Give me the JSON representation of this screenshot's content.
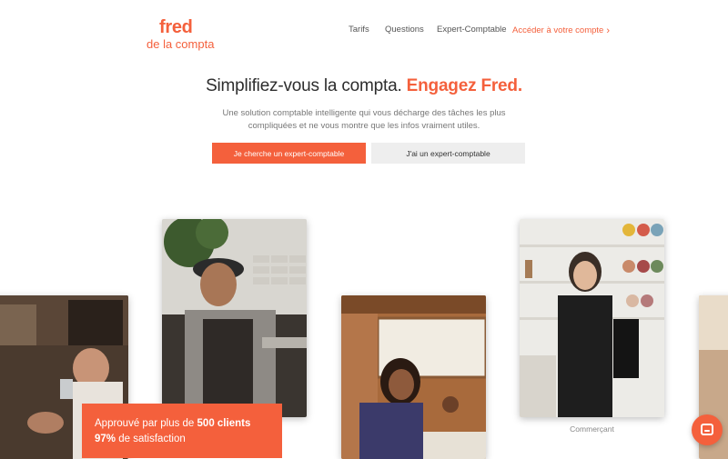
{
  "brand": {
    "name_line1": "fred",
    "name_line2": "de la compta",
    "accent": "#f4603c"
  },
  "nav": {
    "items": [
      "Tarifs",
      "Questions",
      "Expert-Comptable"
    ],
    "cta": "Accéder à votre compte",
    "cta_icon": "chevron-right-icon"
  },
  "hero": {
    "title_main": "Simplifiez-vous la compta.",
    "title_accent": "Engagez Fred.",
    "subtitle": "Une solution comptable intelligente qui vous décharge des tâches les plus compliquées et ne vous montre que les infos vraiment utiles.",
    "btn_primary": "Je cherche un expert-comptable",
    "btn_secondary": "J'ai un expert-comptable"
  },
  "photos": {
    "caption_4": "Commerçant"
  },
  "badge": {
    "line1_prefix": "Approuvé par plus de",
    "line1_number": "500 clients",
    "line2_number": "97%",
    "line2_suffix": "de satisfaction"
  },
  "chat": {
    "icon": "chat-icon"
  }
}
